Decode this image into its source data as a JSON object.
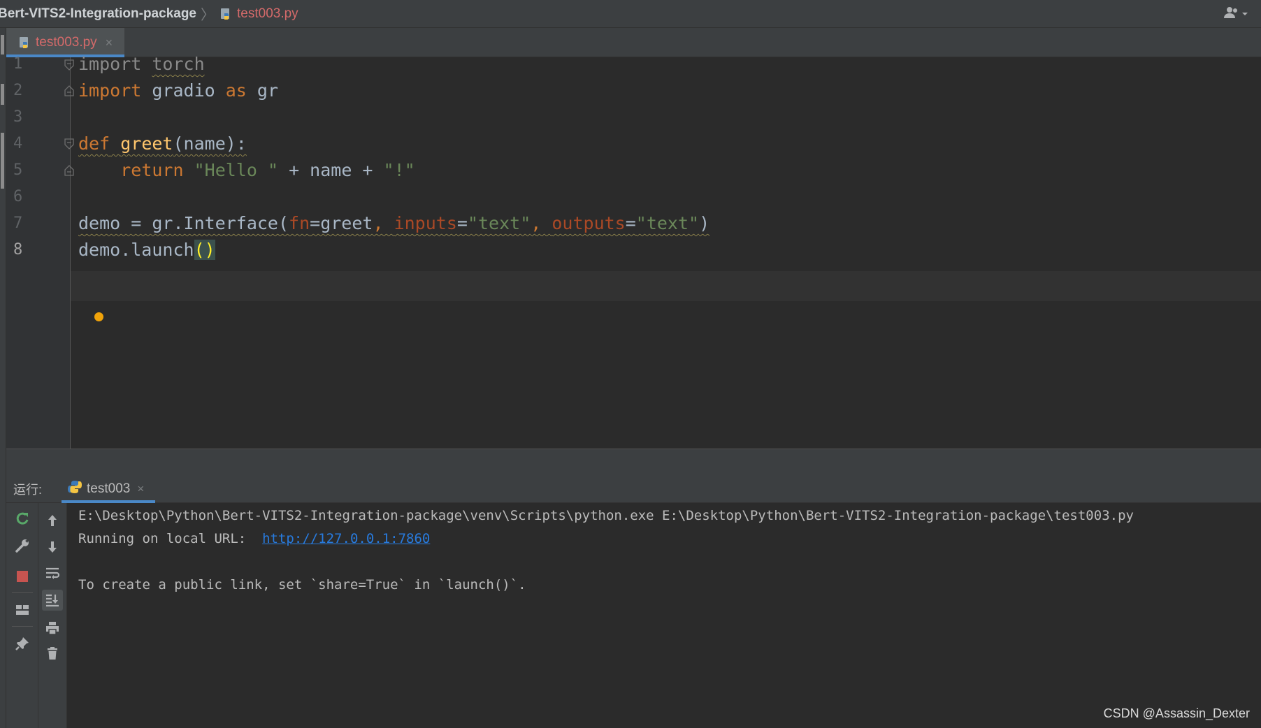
{
  "navbar": {
    "project": "Bert-VITS2-Integration-package",
    "file": "test003.py"
  },
  "editor_tab": {
    "label": "test003.py",
    "close": "×"
  },
  "editor": {
    "line_numbers": [
      "1",
      "2",
      "3",
      "4",
      "5",
      "6",
      "7",
      "8"
    ],
    "current_line": "8",
    "code": {
      "l1_kw": "import",
      "l1_mod": "torch",
      "l2_kw": "import",
      "l2_mod": "gradio",
      "l2_as": "as",
      "l2_alias": "gr",
      "l4_kw": "def",
      "l4_fn": "greet",
      "l4_rest": "(name):",
      "l5_kw": "return",
      "l5_s1": "\"Hello \"",
      "l5_mid": " + name + ",
      "l5_s2": "\"!\"",
      "l7_a": "demo = gr.Interface(",
      "l7_p1": "fn",
      "l7_b": "=greet",
      "l7_c": ", ",
      "l7_p2": "inputs",
      "l7_d": "=",
      "l7_s1": "\"text\"",
      "l7_e": ", ",
      "l7_p3": "outputs",
      "l7_f": "=",
      "l7_s2": "\"text\"",
      "l7_g": ")",
      "l8_a": "demo.launch",
      "l8_b": "()"
    }
  },
  "run": {
    "label": "运行:",
    "tab": "test003",
    "tab_close": "×",
    "console": {
      "cmd": "E:\\Desktop\\Python\\Bert-VITS2-Integration-package\\venv\\Scripts\\python.exe E:\\Desktop\\Python\\Bert-VITS2-Integration-package\\test003.py",
      "running_prefix": "Running on local URL:  ",
      "url": "http://127.0.0.1:7860",
      "share_hint": "To create a public link, set `share=True` in `launch()`."
    },
    "toolbar_left": [
      "rerun-icon",
      "wrench-icon",
      "stop-icon",
      "layout-icon",
      "pin-icon"
    ],
    "toolbar_right": [
      "arrow-up-icon",
      "arrow-down-icon",
      "soft-wrap-icon",
      "scroll-to-end-icon",
      "print-icon",
      "trash-icon"
    ]
  },
  "watermark": "CSDN @Assassin_Dexter",
  "colors": {
    "keyword": "#cc7832",
    "function": "#ffc66d",
    "string": "#6a8759",
    "param": "#aa4926",
    "link": "#287bde",
    "accent": "#4a88c7",
    "stop": "#c75450"
  }
}
